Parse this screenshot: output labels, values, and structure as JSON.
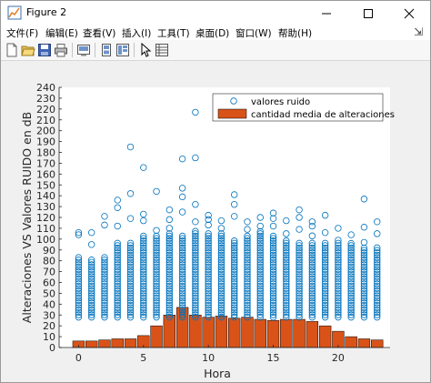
{
  "window": {
    "title": "Figure 2"
  },
  "menu": {
    "items": [
      "文件(F)",
      "编辑(E)",
      "查看(V)",
      "插入(I)",
      "工具(T)",
      "桌面(D)",
      "窗口(W)",
      "帮助(H)"
    ]
  },
  "toolbar": {
    "buttons": [
      "new-figure-icon",
      "open-file-icon",
      "save-icon",
      "print-icon",
      "link-plot-icon",
      "hide-plot-tools-icon",
      "show-plot-tools-icon",
      "edit-plot-arrow-icon",
      "property-inspector-icon"
    ]
  },
  "colors": {
    "scatter": "#0072BD",
    "bar": "#D95319"
  },
  "chart_data": {
    "type": "bar+scatter",
    "xlabel": "Hora",
    "ylabel": "Alteraciones VS Valores RUIDO en dB",
    "xlim": [
      -1.5,
      24
    ],
    "ylim": [
      0,
      240
    ],
    "x_ticks": [
      0,
      5,
      10,
      15,
      20
    ],
    "y_ticks": [
      0,
      10,
      20,
      30,
      40,
      50,
      60,
      70,
      80,
      90,
      100,
      110,
      120,
      130,
      140,
      150,
      160,
      170,
      180,
      190,
      200,
      210,
      220,
      230,
      240
    ],
    "legend": {
      "location": "top-right",
      "entries": [
        "valores ruido",
        "cantidad media de alteraciones"
      ]
    },
    "bar_series": {
      "name": "cantidad media de alteraciones",
      "x": [
        0,
        1,
        2,
        3,
        4,
        5,
        6,
        7,
        8,
        9,
        10,
        11,
        12,
        13,
        14,
        15,
        16,
        17,
        18,
        19,
        20,
        21,
        22,
        23
      ],
      "values": [
        6,
        6,
        7,
        8,
        8,
        11,
        20,
        30,
        37,
        30,
        28,
        29,
        27,
        28,
        26,
        25,
        26,
        26,
        24,
        20,
        15,
        10,
        8,
        7
      ]
    },
    "scatter_series": {
      "name": "valores ruido",
      "x": [
        0,
        1,
        2,
        3,
        4,
        5,
        6,
        7,
        8,
        9,
        10,
        11,
        12,
        13,
        14,
        15,
        16,
        17,
        18,
        19,
        20,
        21,
        22,
        23
      ],
      "min": [
        28,
        28,
        28,
        28,
        28,
        28,
        28,
        28,
        28,
        28,
        28,
        28,
        28,
        28,
        28,
        28,
        28,
        28,
        28,
        28,
        28,
        28,
        28,
        28
      ],
      "dense_max": [
        84,
        83,
        85,
        97,
        98,
        103,
        104,
        106,
        103,
        108,
        106,
        107,
        100,
        103,
        107,
        104,
        100,
        98,
        98,
        97,
        97,
        95,
        93,
        90
      ],
      "outliers": [
        [
          0,
          104
        ],
        [
          0,
          106
        ],
        [
          1,
          95
        ],
        [
          1,
          106
        ],
        [
          2,
          113
        ],
        [
          2,
          121
        ],
        [
          3,
          112
        ],
        [
          3,
          129
        ],
        [
          3,
          136
        ],
        [
          4,
          119
        ],
        [
          4,
          142
        ],
        [
          4,
          185
        ],
        [
          5,
          117
        ],
        [
          5,
          123
        ],
        [
          5,
          166
        ],
        [
          6,
          108
        ],
        [
          6,
          144
        ],
        [
          7,
          110
        ],
        [
          7,
          118
        ],
        [
          7,
          127
        ],
        [
          8,
          125
        ],
        [
          8,
          139
        ],
        [
          8,
          147
        ],
        [
          8,
          174
        ],
        [
          9,
          116
        ],
        [
          9,
          132
        ],
        [
          9,
          175
        ],
        [
          9,
          217
        ],
        [
          10,
          113
        ],
        [
          10,
          118
        ],
        [
          10,
          122
        ],
        [
          11,
          110
        ],
        [
          11,
          117
        ],
        [
          12,
          121
        ],
        [
          12,
          132
        ],
        [
          12,
          141
        ],
        [
          13,
          109
        ],
        [
          13,
          116
        ],
        [
          14,
          107
        ],
        [
          14,
          112
        ],
        [
          14,
          120
        ],
        [
          15,
          112
        ],
        [
          15,
          119
        ],
        [
          15,
          124
        ],
        [
          16,
          105
        ],
        [
          16,
          117
        ],
        [
          17,
          109
        ],
        [
          17,
          120
        ],
        [
          17,
          127
        ],
        [
          18,
          103
        ],
        [
          18,
          112
        ],
        [
          18,
          116
        ],
        [
          19,
          106
        ],
        [
          19,
          122
        ],
        [
          20,
          99
        ],
        [
          20,
          110
        ],
        [
          21,
          96
        ],
        [
          21,
          104
        ],
        [
          22,
          97
        ],
        [
          22,
          111
        ],
        [
          22,
          137
        ],
        [
          23,
          92
        ],
        [
          23,
          105
        ],
        [
          23,
          116
        ]
      ]
    }
  }
}
